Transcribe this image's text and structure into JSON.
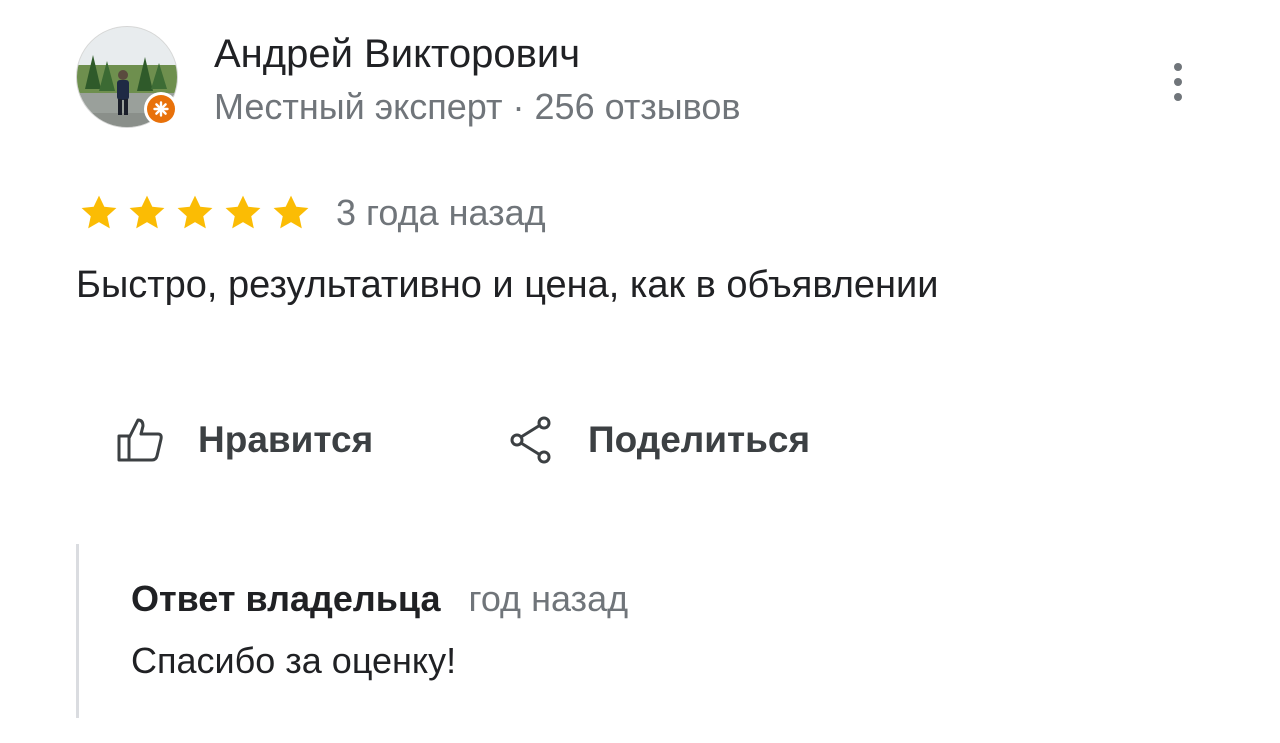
{
  "author": {
    "name": "Андрей Викторович",
    "meta": "Местный эксперт · 256 отзывов",
    "avatar_icon": "user-photo-avatar",
    "badge_icon": "local-guide-badge-icon"
  },
  "rating": {
    "stars": 5,
    "max": 5,
    "star_color": "#fbbc04",
    "date": "3 года назад"
  },
  "review": {
    "text": "Быстро, результативно и цена, как в объявлении"
  },
  "actions": {
    "like_label": "Нравится",
    "share_label": "Поделиться"
  },
  "owner_reply": {
    "title": "Ответ владельца",
    "date": "год назад",
    "text": "Спасибо за оценку!"
  },
  "colors": {
    "text_primary": "#202124",
    "text_secondary": "#70757a",
    "badge": "#e8710a",
    "divider": "#dadce0"
  }
}
